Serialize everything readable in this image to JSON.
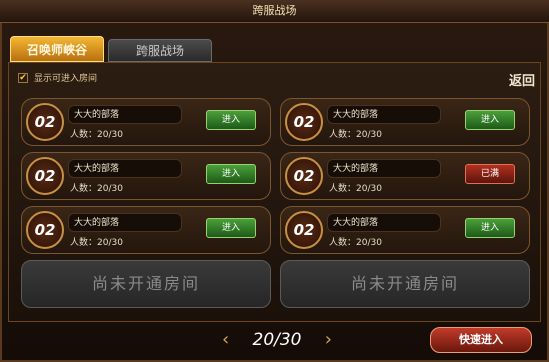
{
  "title": "跨服战场",
  "tabs": [
    {
      "label": "召唤师峡谷",
      "active": true
    },
    {
      "label": "跨服战场",
      "active": false
    }
  ],
  "filter": {
    "label": "显示可进入房间",
    "checked": true,
    "check_mark": "✔"
  },
  "back_label": "返回",
  "rooms": [
    {
      "number": "02",
      "name": "大大的部落",
      "count": "人数：20/30",
      "button": "进入",
      "status": "enter"
    },
    {
      "number": "02",
      "name": "大大的部落",
      "count": "人数：20/30",
      "button": "进入",
      "status": "enter"
    },
    {
      "number": "02",
      "name": "大大的部落",
      "count": "人数：20/30",
      "button": "进入",
      "status": "enter"
    },
    {
      "number": "02",
      "name": "大大的部落",
      "count": "人数：20/30",
      "button": "进入",
      "status": "enter"
    },
    {
      "number": "02",
      "name": "大大的部落",
      "count": "人数：20/30",
      "button": "已满",
      "status": "full"
    },
    {
      "number": "02",
      "name": "大大的部落",
      "count": "人数：20/30",
      "button": "进入",
      "status": "enter"
    }
  ],
  "empty_rooms": [
    "尚未开通房间",
    "尚未开通房间"
  ],
  "pager": {
    "text": "20/30",
    "prev_icon": "‹",
    "next_icon": "›"
  },
  "quick_enter_label": "快速进入",
  "colors": {
    "enter": "#2f7a25",
    "full": "#8a2416",
    "accent": "#f4b733"
  }
}
